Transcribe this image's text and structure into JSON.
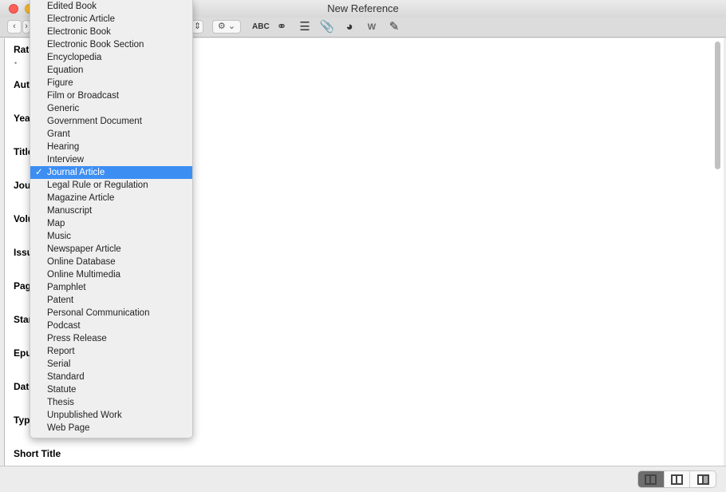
{
  "window": {
    "title": "New Reference"
  },
  "toolbar": {
    "icons": [
      "back-arrow-icon",
      "forward-arrow-icon",
      "stepper-icon",
      "gear-icon",
      "spellcheck-icon",
      "link-icon",
      "insert-text-icon",
      "attachment-icon",
      "pie-chart-icon",
      "word-icon",
      "edit-notes-icon"
    ],
    "gear_label": "⚙ ⌄"
  },
  "fields": [
    "Rating",
    "Authors",
    "Year",
    "Title",
    "Journal",
    "Volume",
    "Issue",
    "Pages",
    "Start Page",
    "Epub",
    "Date",
    "Type",
    "Short Title"
  ],
  "rating": {
    "stars": "• • • • •"
  },
  "reference_type_menu": {
    "selected": "Journal Article",
    "check": "✓",
    "items": [
      "Edited Book",
      "Electronic Article",
      "Electronic Book",
      "Electronic Book Section",
      "Encyclopedia",
      "Equation",
      "Figure",
      "Film or Broadcast",
      "Generic",
      "Government Document",
      "Grant",
      "Hearing",
      "Interview",
      "Journal Article",
      "Legal Rule or Regulation",
      "Magazine Article",
      "Manuscript",
      "Map",
      "Music",
      "Newspaper Article",
      "Online Database",
      "Online Multimedia",
      "Pamphlet",
      "Patent",
      "Personal Communication",
      "Podcast",
      "Press Release",
      "Report",
      "Serial",
      "Standard",
      "Statute",
      "Thesis",
      "Unpublished Work",
      "Web Page"
    ]
  },
  "layout_buttons": [
    "layout-left-pane",
    "layout-split",
    "layout-right-pane"
  ],
  "colors": {
    "selection": "#3d8ef2"
  }
}
